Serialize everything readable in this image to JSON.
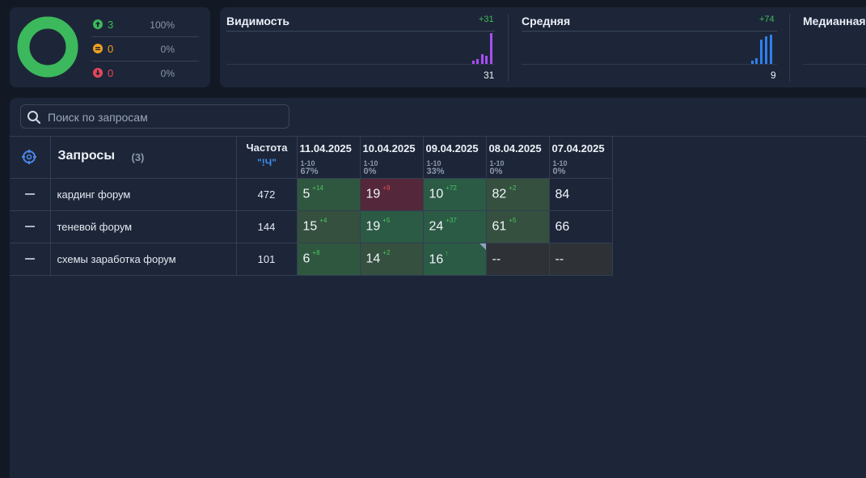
{
  "distribution": {
    "colors": {
      "up": "#3bb95c",
      "same": "#f0a020",
      "down": "#e8465a"
    },
    "rows": [
      {
        "icon": "arrow-up-icon",
        "count": "3",
        "pct": "100%"
      },
      {
        "icon": "equals-icon",
        "count": "0",
        "pct": "0%"
      },
      {
        "icon": "arrow-down-icon",
        "count": "0",
        "pct": "0%"
      }
    ],
    "donut_share_up": 1.0
  },
  "metrics": [
    {
      "title": "Видимость",
      "delta": "+31",
      "value": "31",
      "color": "#a64ff0"
    },
    {
      "title": "Средняя",
      "delta": "+74",
      "value": "9",
      "color": "#2f7ff0"
    },
    {
      "title": "Медианная",
      "delta": "",
      "value": ""
    }
  ],
  "search": {
    "placeholder": "Поиск по запросам"
  },
  "table": {
    "queries_label": "Запросы",
    "queries_count": "(3)",
    "freq_label": "Частота",
    "freq_sub": "\"!Ч\"",
    "dates": [
      {
        "date": "11.04.2025",
        "range": "1-10",
        "pct": "67%"
      },
      {
        "date": "10.04.2025",
        "range": "1-10",
        "pct": "0%"
      },
      {
        "date": "09.04.2025",
        "range": "1-10",
        "pct": "33%"
      },
      {
        "date": "08.04.2025",
        "range": "1-10",
        "pct": "0%"
      },
      {
        "date": "07.04.2025",
        "range": "1-10",
        "pct": "0%"
      }
    ],
    "rows": [
      {
        "query": "кардинг форум",
        "freq": "472",
        "cells": [
          {
            "value": "5",
            "change": "+14"
          },
          {
            "value": "19",
            "change": "+9"
          },
          {
            "value": "10",
            "change": "+72"
          },
          {
            "value": "82",
            "change": "+2"
          },
          {
            "value": "84",
            "change": ""
          }
        ]
      },
      {
        "query": "теневой форум",
        "freq": "144",
        "cells": [
          {
            "value": "15",
            "change": "+4"
          },
          {
            "value": "19",
            "change": "+5"
          },
          {
            "value": "24",
            "change": "+37"
          },
          {
            "value": "61",
            "change": "+5"
          },
          {
            "value": "66",
            "change": ""
          }
        ]
      },
      {
        "query": "схемы заработка форум",
        "freq": "101",
        "cells": [
          {
            "value": "6",
            "change": "+8"
          },
          {
            "value": "14",
            "change": "+2"
          },
          {
            "value": "16",
            "change": "↑"
          },
          {
            "value": "--",
            "change": ""
          },
          {
            "value": "--",
            "change": ""
          }
        ]
      }
    ]
  }
}
